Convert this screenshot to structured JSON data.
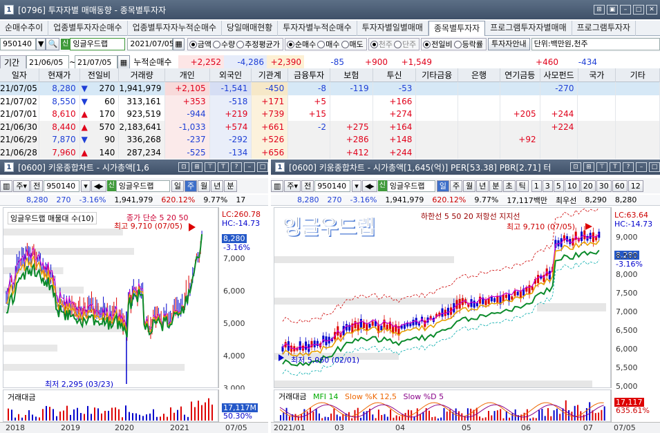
{
  "window": {
    "badge": "1",
    "title": "[0796] 투자자별 매매동향 - 종목별투자자"
  },
  "tabs": [
    "순매수추이",
    "업종별투자자순매수",
    "업종별투자자누적순매수",
    "당일매매현황",
    "투자자별누적순매수",
    "투자자별일별매매",
    "종목별투자자",
    "프로그램투자자별매매",
    "프로그램투자자"
  ],
  "active_tab": "종목별투자자",
  "controls": {
    "code": "950140",
    "sin": "신",
    "name": "잉글우드랩",
    "date": "2021/07/05",
    "r1": [
      "금액",
      "수량",
      "추정평균가"
    ],
    "r2": [
      "순매수",
      "매수",
      "매도"
    ],
    "r3": [
      "천주",
      "단주"
    ],
    "r4": [
      "전일비",
      "등락률"
    ],
    "guide_btn": "투자자안내",
    "unit": "단위:백만원,천주"
  },
  "period": {
    "label": "기간",
    "from": "21/06/05",
    "to": "21/07/05",
    "cum_label": "누적순매수"
  },
  "summary": {
    "개인": "+2,252",
    "외국인": "-4,286",
    "기관계": "+2,390",
    "금융투자": "-85",
    "보험": "+900",
    "투신": "+1,549",
    "연기금등": "+460",
    "사모펀드": "-434"
  },
  "columns": [
    "일자",
    "현재가",
    "전일비",
    "거래량",
    "개인",
    "외국인",
    "기관계",
    "금융투자",
    "보험",
    "투신",
    "기타금융",
    "은행",
    "연기금등",
    "사모펀드",
    "국가",
    "기타"
  ],
  "rows": [
    {
      "date": "21/07/05",
      "price": "8,280",
      "dir": "down",
      "chg": "270",
      "vol": "1,941,979",
      "개인": "+2,105",
      "외국인": "-1,541",
      "기관계": "-450",
      "금융투자": "-8",
      "보험": "-119",
      "투신": "-53",
      "기타금융": "",
      "은행": "",
      "연기금등": "",
      "사모펀드": "-270",
      "국가": "",
      "기타": ""
    },
    {
      "date": "21/07/02",
      "price": "8,550",
      "dir": "down",
      "chg": "60",
      "vol": "313,161",
      "개인": "+353",
      "외국인": "-518",
      "기관계": "+171",
      "금융투자": "+5",
      "보험": "",
      "투신": "+166",
      "기타금융": "",
      "은행": "",
      "연기금등": "",
      "사모펀드": "",
      "국가": "",
      "기타": ""
    },
    {
      "date": "21/07/01",
      "price": "8,610",
      "dir": "up",
      "chg": "170",
      "vol": "923,519",
      "개인": "-944",
      "외국인": "+219",
      "기관계": "+739",
      "금융투자": "+15",
      "보험": "",
      "투신": "+274",
      "기타금융": "",
      "은행": "",
      "연기금등": "+205",
      "사모펀드": "+244",
      "국가": "",
      "기타": ""
    },
    {
      "date": "21/06/30",
      "price": "8,440",
      "dir": "up",
      "chg": "570",
      "vol": "2,183,641",
      "개인": "-1,033",
      "외국인": "+574",
      "기관계": "+661",
      "금융투자": "-2",
      "보험": "+275",
      "투신": "+164",
      "기타금융": "",
      "은행": "",
      "연기금등": "",
      "사모펀드": "+224",
      "국가": "",
      "기타": ""
    },
    {
      "date": "21/06/29",
      "price": "7,870",
      "dir": "down",
      "chg": "90",
      "vol": "336,268",
      "개인": "-237",
      "외국인": "-292",
      "기관계": "+526",
      "금융투자": "",
      "보험": "+286",
      "투신": "+148",
      "기타금융": "",
      "은행": "",
      "연기금등": "+92",
      "사모펀드": "",
      "국가": "",
      "기타": ""
    },
    {
      "date": "21/06/28",
      "price": "7,960",
      "dir": "up",
      "chg": "140",
      "vol": "287,234",
      "개인": "-525",
      "외국인": "-134",
      "기관계": "+656",
      "금융투자": "",
      "보험": "+412",
      "투신": "+244",
      "기타금융": "",
      "은행": "",
      "연기금등": "",
      "사모펀드": "",
      "국가": "",
      "기타": ""
    }
  ],
  "left_chart": {
    "title": "[0600] 키움종합차트 - 시가총액[1,6",
    "code": "950140",
    "sin": "신",
    "name": "잉글우드랩",
    "periods": [
      "일",
      "주",
      "월",
      "년",
      "분"
    ],
    "sel_period": "주",
    "quote": [
      "8,280",
      "270",
      "-3.16%",
      "1,941,979",
      "620.12%",
      "9.77%",
      "17"
    ],
    "legend": "잉글우드랩 매물대 수(10)",
    "ma": "종가 단순 5 20 50",
    "high": "최고 9,710 (07/05)",
    "low": "최저 2,295 (03/23)",
    "lc": "LC:260.78",
    "hc": "HC:-14.73",
    "price": "8,280",
    "pct": "-3.16%",
    "yticks": [
      "7,000",
      "6,000",
      "5,000",
      "4,000",
      "3,000"
    ],
    "vol_label": "거래대금",
    "vol_val": "17,117M",
    "vol_pct": "50.30%",
    "xticks": [
      "2018",
      "2019",
      "2020",
      "2021",
      "07/05"
    ]
  },
  "right_chart": {
    "title": "[0600] 키움종합차트 - 시가총액[1,645(억)] PER[53.38] PBR[2.71] 터",
    "code": "950140",
    "sin": "신",
    "name": "잉글우드랩",
    "periods": [
      "일",
      "주",
      "월",
      "년",
      "분",
      "초",
      "틱"
    ],
    "sel_period": "일",
    "nums": [
      "1",
      "3",
      "5",
      "10",
      "20",
      "30",
      "60",
      "12"
    ],
    "quote": [
      "8,280",
      "270",
      "-3.16%",
      "1,941,979",
      "620.12%",
      "9.77%",
      "17,117백만",
      "최우선",
      "8,290",
      "8,280"
    ],
    "overlay": "잉글우드랩",
    "legend": "하한선 5 50 20 저항선 지지선",
    "high": "최고 9,710 (07/05)",
    "low": "최저 5,060 (02/01)",
    "lc": "LC:63.64",
    "hc": "HC:-14.73",
    "price": "8,280",
    "pct": "-3.16%",
    "yticks": [
      "9,000",
      "8,500",
      "8,000",
      "7,500",
      "7,000",
      "6,500",
      "6,000",
      "5,500",
      "5,000"
    ],
    "vol_label": "거래대금",
    "ind": "MFI 14",
    "sk": "Slow %K 12,5",
    "sd": "Slow %D 5",
    "vol_val": "17,117",
    "vol_pct": "635.61%",
    "xticks": [
      "2021/01",
      "03",
      "04",
      "05",
      "06",
      "07",
      "07/05"
    ]
  }
}
